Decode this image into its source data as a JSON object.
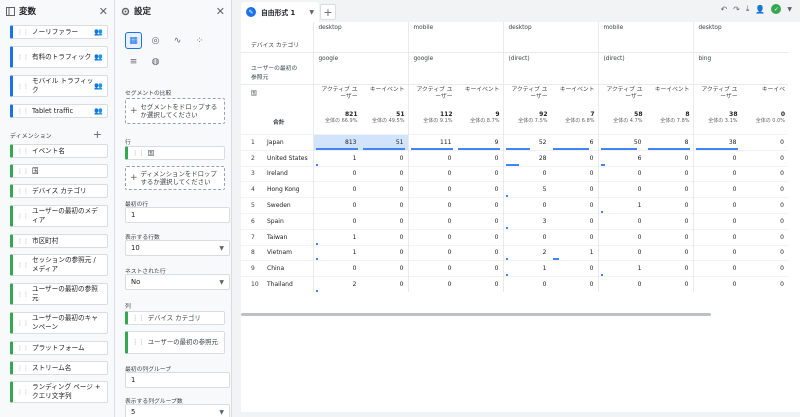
{
  "variables_panel": {
    "title": "変数",
    "top_dimensions": [
      {
        "label": "ノーリファラー"
      },
      {
        "label": "有料のトラフィック"
      },
      {
        "label": "モバイル トラフィック"
      },
      {
        "label": "Tablet traffic"
      }
    ],
    "dimensions_label": "ディメンション",
    "dimensions": [
      "イベント名",
      "国",
      "デバイス カテゴリ",
      "ユーザーの最初のメディア",
      "市区町村",
      "セッションの参照元 / メディア",
      "ユーザーの最初の参照元",
      "ユーザーの最初のキャンペーン",
      "プラットフォーム",
      "ストリーム名",
      "ランディング ページ + クエリ文字列"
    ]
  },
  "settings_panel": {
    "title": "設定",
    "segment_compare_label": "セグメントの比較",
    "segment_drop_text": "セグメントをドロップするか選択してください",
    "rows_label": "行",
    "row_dimension": "国",
    "row_drop_text": "ディメンションをドロップするか選択してください",
    "start_row_label": "最初の行",
    "start_row_value": "1",
    "show_rows_label": "表示する行数",
    "show_rows_value": "10",
    "nested_rows_label": "ネストされた行",
    "nested_rows_value": "No",
    "columns_label": "列",
    "column_dimensions": [
      "デバイス カテゴリ",
      "ユーザーの最初の参照元"
    ],
    "start_col_group_label": "最初の列グループ",
    "start_col_group_value": "1",
    "show_col_groups_label": "表示する列グループ数",
    "show_col_groups_value": "5"
  },
  "main": {
    "tab_label": "自由形式 1",
    "add_tab_label": "+",
    "table": {
      "dim_header_1": "デバイス カテゴリ",
      "dim_header_2": "ユーザーの最初の参照元",
      "row_dim_header": "国",
      "total_label": "合計",
      "column_groups": [
        {
          "device": "desktop",
          "source": "google",
          "m1": "アクティブ ユーザー",
          "m2": "キーイベント",
          "t1": "821",
          "t1s": "全体の 66.9%",
          "t2": "51",
          "t2s": "全体の 49.5%"
        },
        {
          "device": "mobile",
          "source": "google",
          "m1": "アクティブ ユーザー",
          "m2": "キーイベント",
          "t1": "112",
          "t1s": "全体の 9.1%",
          "t2": "9",
          "t2s": "全体の 8.7%"
        },
        {
          "device": "desktop",
          "source": "(direct)",
          "m1": "アクティブ ユーザー",
          "m2": "キーイベント",
          "t1": "92",
          "t1s": "全体の 7.5%",
          "t2": "7",
          "t2s": "全体の 6.8%"
        },
        {
          "device": "mobile",
          "source": "(direct)",
          "m1": "アクティブ ユーザー",
          "m2": "キーイベント",
          "t1": "58",
          "t1s": "全体の 4.7%",
          "t2": "8",
          "t2s": "全体の 7.8%"
        },
        {
          "device": "desktop",
          "source": "bing",
          "m1": "アクティブ ユーザー",
          "m2": "キーイベ",
          "t1": "38",
          "t1s": "全体の 3.1%",
          "t2": "0",
          "t2s": "全体の 0.0%"
        }
      ],
      "rows": [
        {
          "idx": "1",
          "country": "Japan",
          "values": [
            "813",
            "51",
            "111",
            "9",
            "52",
            "6",
            "50",
            "8",
            "38",
            "0"
          ]
        },
        {
          "idx": "2",
          "country": "United States",
          "values": [
            "1",
            "0",
            "0",
            "0",
            "28",
            "0",
            "6",
            "0",
            "0",
            "0"
          ]
        },
        {
          "idx": "3",
          "country": "Ireland",
          "values": [
            "0",
            "0",
            "0",
            "0",
            "0",
            "0",
            "0",
            "0",
            "0",
            "0"
          ]
        },
        {
          "idx": "4",
          "country": "Hong Kong",
          "values": [
            "0",
            "0",
            "0",
            "0",
            "5",
            "0",
            "0",
            "0",
            "0",
            "0"
          ]
        },
        {
          "idx": "5",
          "country": "Sweden",
          "values": [
            "0",
            "0",
            "0",
            "0",
            "0",
            "0",
            "1",
            "0",
            "0",
            "0"
          ]
        },
        {
          "idx": "6",
          "country": "Spain",
          "values": [
            "0",
            "0",
            "0",
            "0",
            "3",
            "0",
            "0",
            "0",
            "0",
            "0"
          ]
        },
        {
          "idx": "7",
          "country": "Taiwan",
          "values": [
            "1",
            "0",
            "0",
            "0",
            "0",
            "0",
            "0",
            "0",
            "0",
            "0"
          ]
        },
        {
          "idx": "8",
          "country": "Vietnam",
          "values": [
            "1",
            "0",
            "0",
            "0",
            "2",
            "1",
            "0",
            "0",
            "0",
            "0"
          ]
        },
        {
          "idx": "9",
          "country": "China",
          "values": [
            "0",
            "0",
            "0",
            "0",
            "1",
            "0",
            "1",
            "0",
            "0",
            "0"
          ]
        },
        {
          "idx": "10",
          "country": "Thailand",
          "values": [
            "2",
            "0",
            "0",
            "0",
            "0",
            "0",
            "0",
            "0",
            "0",
            "0"
          ]
        }
      ]
    }
  }
}
